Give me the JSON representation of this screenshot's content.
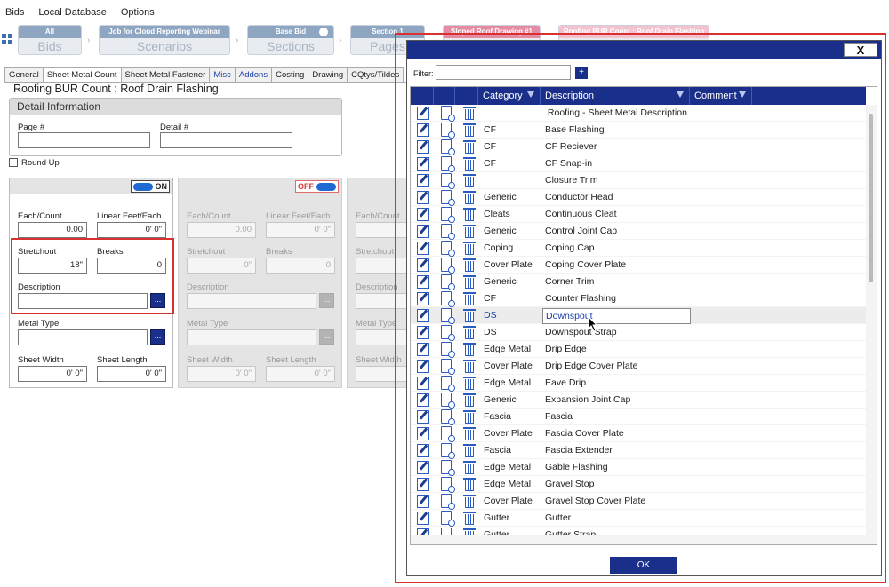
{
  "menubar": {
    "items": [
      "Bids",
      "Local Database",
      "Options"
    ]
  },
  "breadcrumbs": [
    {
      "top": "All",
      "bottom": "Bids"
    },
    {
      "top": "Job for Cloud Reporting Webinar",
      "bottom": "Scenarios"
    },
    {
      "top": "Base Bid",
      "bottom": "Sections"
    },
    {
      "top": "Section 1",
      "bottom": "Pages"
    },
    {
      "top": "Sloped Roof Drawing #1",
      "bottom": ""
    },
    {
      "top": "Roofing BUR Count : Roof Drain Flashing",
      "bottom": ""
    }
  ],
  "tabs": [
    "General",
    "Sheet Metal Count",
    "Sheet Metal Fastener",
    "Misc",
    "Addons",
    "Costing",
    "Drawing",
    "CQtys/Tildes"
  ],
  "form": {
    "title": "Roofing BUR Count : Roof Drain Flashing",
    "detail_info": {
      "heading": "Detail Information",
      "page_label": "Page #",
      "detail_label": "Detail #"
    },
    "round_up": "Round Up"
  },
  "cards": [
    {
      "toggle": "ON",
      "each_count_label": "Each/Count",
      "each_count": "0.00",
      "linear_feet_label": "Linear Feet/Each",
      "linear_feet": "0' 0\"",
      "stretchout_label": "Stretchout",
      "stretchout": "18\"",
      "breaks_label": "Breaks",
      "breaks": "0",
      "description_label": "Description",
      "metal_type_label": "Metal Type",
      "sheet_width_label": "Sheet Width",
      "sheet_width": "0' 0\"",
      "sheet_length_label": "Sheet Length",
      "sheet_length": "0' 0\""
    },
    {
      "toggle": "OFF",
      "each_count_label": "Each/Count",
      "each_count": "0.00",
      "linear_feet_label": "Linear Feet/Each",
      "linear_feet": "0' 0\"",
      "stretchout_label": "Stretchout",
      "stretchout": "0\"",
      "breaks_label": "Breaks",
      "breaks": "0",
      "description_label": "Description",
      "metal_type_label": "Metal Type",
      "sheet_width_label": "Sheet Width",
      "sheet_width": "0' 0\"",
      "sheet_length_label": "Sheet Length",
      "sheet_length": "0' 0\""
    },
    {
      "each_count_label": "Each/Count",
      "stretchout_label": "Stretchout",
      "description_label": "Description",
      "metal_type_label": "Metal Type",
      "sheet_width_label": "Sheet Width"
    }
  ],
  "dots_label": "...",
  "dialog": {
    "close_label": "X",
    "filter_label": "Filter:",
    "filter_value": "",
    "filter_button": "+",
    "columns": {
      "category": "Category",
      "description": "Description",
      "comment": "Comment"
    },
    "ok_label": "OK",
    "rows": [
      {
        "category": "",
        "description": ".Roofing - Sheet Metal Description"
      },
      {
        "category": "CF",
        "description": "Base Flashing"
      },
      {
        "category": "CF",
        "description": "CF Reciever"
      },
      {
        "category": "CF",
        "description": "CF Snap-in"
      },
      {
        "category": "",
        "description": "Closure Trim"
      },
      {
        "category": "Generic",
        "description": "Conductor Head"
      },
      {
        "category": "Cleats",
        "description": "Continuous Cleat"
      },
      {
        "category": "Generic",
        "description": "Control Joint Cap"
      },
      {
        "category": "Coping",
        "description": "Coping Cap"
      },
      {
        "category": "Cover Plate",
        "description": "Coping Cover Plate"
      },
      {
        "category": "Generic",
        "description": "Corner Trim"
      },
      {
        "category": "CF",
        "description": "Counter Flashing"
      },
      {
        "category": "DS",
        "description": "Downspout",
        "selected": true
      },
      {
        "category": "DS",
        "description": "Downspout Strap"
      },
      {
        "category": "Edge Metal",
        "description": "Drip Edge"
      },
      {
        "category": "Cover Plate",
        "description": "Drip Edge Cover Plate"
      },
      {
        "category": "Edge Metal",
        "description": "Eave Drip"
      },
      {
        "category": "Generic",
        "description": "Expansion Joint Cap"
      },
      {
        "category": "Fascia",
        "description": "Fascia"
      },
      {
        "category": "Cover Plate",
        "description": "Fascia Cover Plate"
      },
      {
        "category": "Fascia",
        "description": "Fascia Extender"
      },
      {
        "category": "Edge Metal",
        "description": "Gable Flashing"
      },
      {
        "category": "Edge Metal",
        "description": "Gravel Stop"
      },
      {
        "category": "Cover Plate",
        "description": "Gravel Stop Cover Plate"
      },
      {
        "category": "Gutter",
        "description": "Gutter"
      },
      {
        "category": "Gutter",
        "description": "Gutter Strap"
      }
    ]
  }
}
